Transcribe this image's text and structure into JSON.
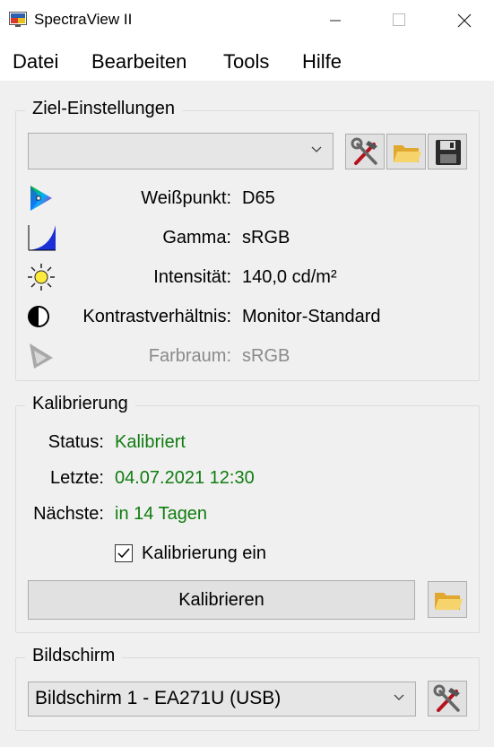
{
  "window": {
    "title": "SpectraView II",
    "app_icon": "nec-monitor-icon",
    "controls": [
      "minimize-icon",
      "maximize-icon",
      "close-icon"
    ]
  },
  "menu": {
    "items": [
      {
        "label": "Datei"
      },
      {
        "label": "Bearbeiten"
      },
      {
        "label": "Tools"
      },
      {
        "label": "Hilfe"
      }
    ]
  },
  "target": {
    "title": "Ziel-Einstellungen",
    "preset_value": "",
    "rows": [
      {
        "label": "Weißpunkt:",
        "value": "D65",
        "icon": "color-triangle-icon",
        "enabled": true
      },
      {
        "label": "Gamma:",
        "value": "sRGB",
        "icon": "gamma-curve-icon",
        "enabled": true
      },
      {
        "label": "Intensität:",
        "value": "140,0 cd/m²",
        "icon": "sun-icon",
        "enabled": true
      },
      {
        "label": "Kontrastverhältnis:",
        "value": "Monitor-Standard",
        "icon": "contrast-icon",
        "enabled": true
      },
      {
        "label": "Farbraum:",
        "value": "sRGB",
        "icon": "gamut-icon",
        "enabled": false
      }
    ]
  },
  "calibration": {
    "title": "Kalibrierung",
    "status_label": "Status:",
    "status_value": "Kalibriert",
    "last_label": "Letzte:",
    "last_value": "04.07.2021 12:30",
    "next_label": "Nächste:",
    "next_value": "in 14 Tagen",
    "enable_label": "Kalibrierung ein",
    "enable_checked": true,
    "button_label": "Kalibrieren",
    "status_color": "#107c10"
  },
  "display": {
    "title": "Bildschirm",
    "selected": "Bildschirm 1 - EA271U (USB)"
  }
}
